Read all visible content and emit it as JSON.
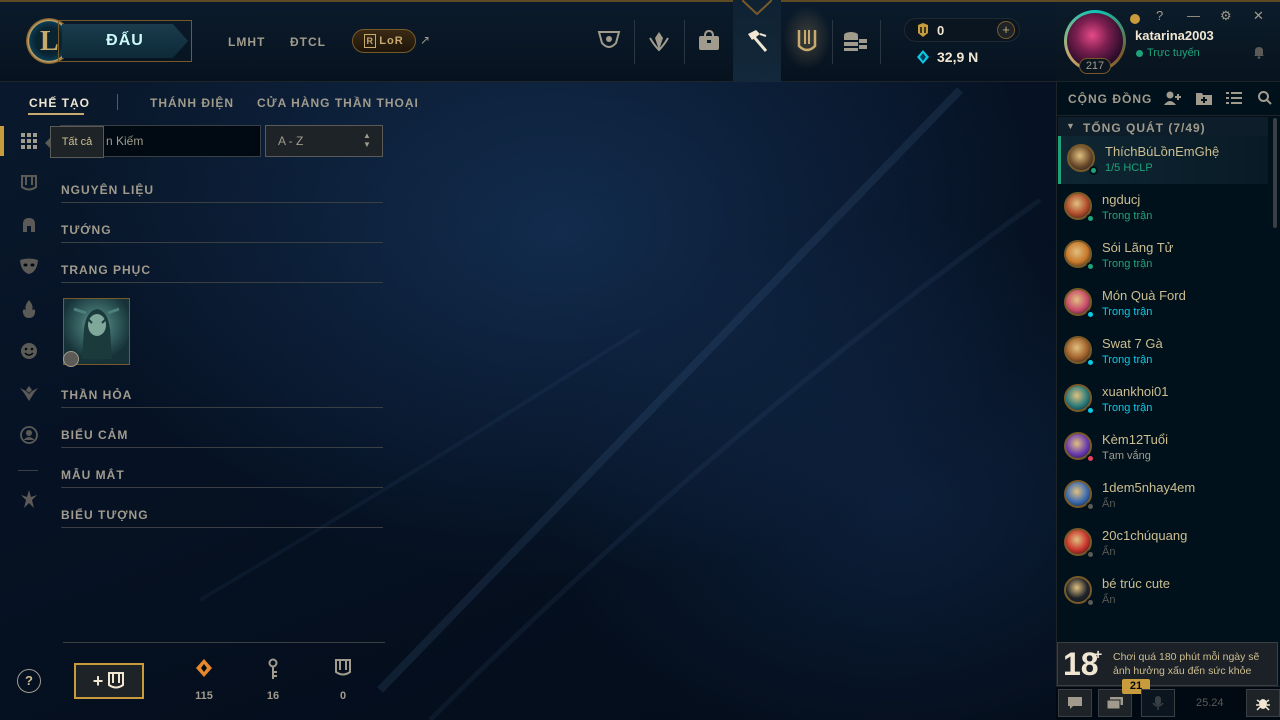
{
  "topbar": {
    "logo_letter": "L",
    "play_label": "ĐẤU",
    "links": [
      "LMHT",
      "ĐTCL"
    ],
    "lor_label": "LoR",
    "ext_arrow": "↗",
    "rp": "0",
    "blue_essence": "32,9 N",
    "plus": "+"
  },
  "profile": {
    "level": "217",
    "username": "katarina2003",
    "status": "Trực tuyến",
    "controls": [
      "?",
      "—",
      "⚙",
      "✕"
    ]
  },
  "subnav": {
    "items": [
      "CHẾ TẠO",
      "THÁNH ĐIỆN",
      "CỬA HÀNG THẦN THOẠI"
    ]
  },
  "filter": {
    "tooltip": "Tất cả",
    "search_value": "n Kiếm",
    "sort_value": "A - Z"
  },
  "categories": [
    "NGUYÊN LIỆU",
    "TƯỚNG",
    "TRANG PHỤC",
    "THẦN HỎA",
    "BIỂU CẢM",
    "MẪU MẮT",
    "BIỂU TƯỢNG"
  ],
  "bottom": {
    "help": "?",
    "craft_plus": "+",
    "stats": [
      "115",
      "16",
      "0"
    ]
  },
  "social": {
    "title": "CỘNG ĐỒNG",
    "group_title": "TỔNG QUÁT (7/49)",
    "friends": [
      {
        "name": "ThíchBúLồnEmGhệ",
        "status": "1/5 HCLP",
        "status_color": "#1ea37a",
        "dot_color": "#1ea37a",
        "avatar_color": "#6b4b2a"
      },
      {
        "name": "ngducj",
        "status": "Trong trận",
        "status_color": "#1ea37a",
        "dot_color": "#1ea37a",
        "avatar_color": "#b04a2a"
      },
      {
        "name": "Sói Lãng Tử",
        "status": "Trong trận",
        "status_color": "#1ea37a",
        "dot_color": "#1ea37a",
        "avatar_color": "#c8782a"
      },
      {
        "name": "Món Quà Ford",
        "status": "Trong trận",
        "status_color": "#0acbe6",
        "dot_color": "#0acbe6",
        "avatar_color": "#c84a6a"
      },
      {
        "name": "Swat 7 Gà",
        "status": "Trong trận",
        "status_color": "#0acbe6",
        "dot_color": "#0acbe6",
        "avatar_color": "#a0602a"
      },
      {
        "name": "xuankhoi01",
        "status": "Trong trận",
        "status_color": "#0acbe6",
        "dot_color": "#0acbe6",
        "avatar_color": "#2a7a7a"
      },
      {
        "name": "Kèm12Tuổi",
        "status": "Tạm vắng",
        "status_color": "#a09b8c",
        "dot_color": "#e84057",
        "avatar_color": "#6a3ab0"
      },
      {
        "name": "1dem5nhay4em",
        "status": "Ẩn",
        "status_color": "#5b5a56",
        "dot_color": "#5b5a56",
        "avatar_color": "#3a6ab0"
      },
      {
        "name": "20c1chúquang",
        "status": "Ẩn",
        "status_color": "#5b5a56",
        "dot_color": "#5b5a56",
        "avatar_color": "#c8322a"
      },
      {
        "name": "bé trúc cute",
        "status": "Ẩn",
        "status_color": "#5b5a56",
        "dot_color": "#5b5a56",
        "avatar_color": "#1e2328"
      }
    ],
    "warning_age": "18",
    "warning_plus": "+",
    "warning_text": "Chơi quá 180 phút mỗi ngày sẽ ảnh hưởng xấu đến sức khỏe",
    "badge": "21",
    "version": "25.24"
  },
  "colors": {
    "gold": "#c8aa6e",
    "teal": "#0ac8b9",
    "online": "#1ea37a",
    "ingame": "#0acbe6"
  }
}
